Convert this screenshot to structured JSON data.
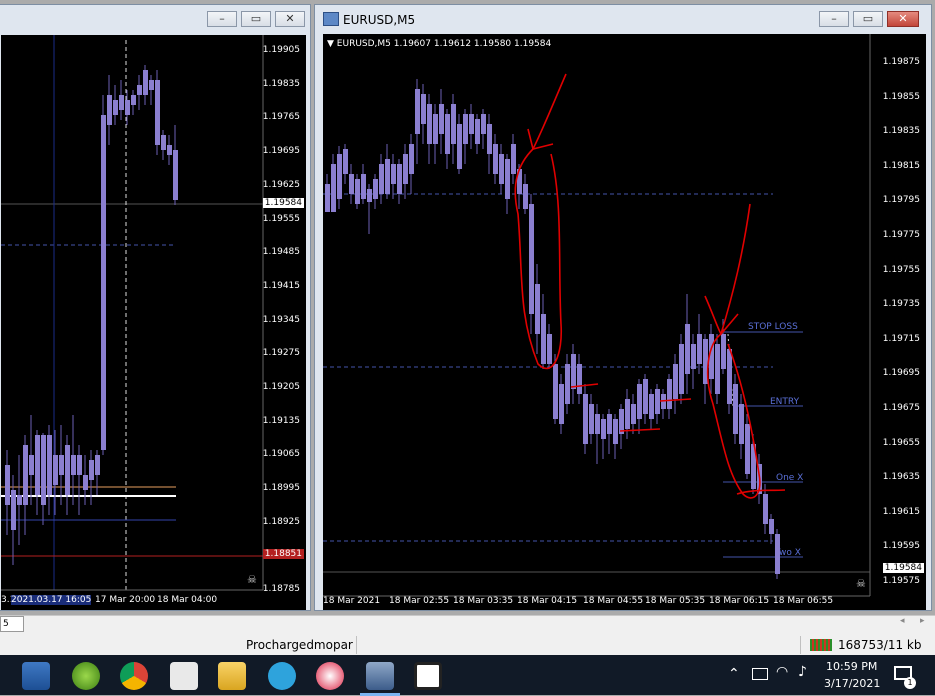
{
  "left_window": {
    "price_labels": [
      "1.19905",
      "1.19835",
      "1.19765",
      "1.19695",
      "1.19625",
      "1.19555",
      "1.19485",
      "1.19415",
      "1.19345",
      "1.19275",
      "1.19205",
      "1.19135",
      "1.19065",
      "1.18995",
      "1.18925",
      "1.18855",
      "1.18785"
    ],
    "current_price": "1.19584",
    "red_tag": "1.18851",
    "time_labels": [
      "3.17",
      "2021.03.17 16:05",
      "17 Mar 20:00",
      "18 Mar 04:00"
    ]
  },
  "right_window": {
    "title": "EURUSD,M5",
    "ohlc_line": "EURUSD,M5  1.19607 1.19612 1.19580 1.19584",
    "price_labels": [
      "1.19875",
      "1.19855",
      "1.19835",
      "1.19815",
      "1.19795",
      "1.19775",
      "1.19755",
      "1.19735",
      "1.19715",
      "1.19695",
      "1.19675",
      "1.19655",
      "1.19635",
      "1.19615",
      "1.19595",
      "1.19575"
    ],
    "current_price": "1.19584",
    "time_labels": [
      "18 Mar 2021",
      "18 Mar 02:55",
      "18 Mar 03:35",
      "18 Mar 04:15",
      "18 Mar 04:55",
      "18 Mar 05:35",
      "18 Mar 06:15",
      "18 Mar 06:55"
    ],
    "annotations": {
      "stop_loss": "STOP LOSS",
      "entry": "ENTRY",
      "one_x": "One X",
      "two_x": "Two X"
    }
  },
  "statusbar": {
    "timeframe_field": "5",
    "profile": "Prochargedmopar",
    "traffic": "168753/11 kb"
  },
  "taskbar": {
    "time": "10:59 PM",
    "date": "3/17/2021",
    "notification_count": "1",
    "apps": [
      "computer-icon",
      "trading-app-icon",
      "chrome-icon",
      "calculator-icon",
      "file-explorer-icon",
      "telegram-icon",
      "paint-icon",
      "metatrader-icon",
      "media-icon"
    ]
  },
  "colors": {
    "candle": "#6b5fb5",
    "bear_candle": "#8b7fd0",
    "drawing_red": "#e00000",
    "level_line": "#5566aa"
  }
}
